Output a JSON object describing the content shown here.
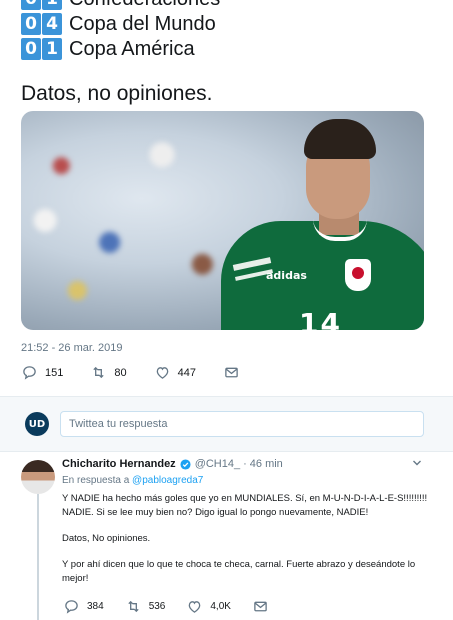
{
  "stats": [
    {
      "digits": [
        "0",
        "1"
      ],
      "label": "Confederaciones"
    },
    {
      "digits": [
        "0",
        "4"
      ],
      "label": "Copa del Mundo"
    },
    {
      "digits": [
        "0",
        "1"
      ],
      "label": "Copa América"
    }
  ],
  "tweet": {
    "text": "Datos, no opiniones.",
    "timestamp": "21:52 - 26 mar. 2019",
    "jersey_number": "14",
    "jersey_brand": "adidas",
    "replies": "151",
    "retweets": "80",
    "likes": "447"
  },
  "reply_composer": {
    "avatar_text": "UD",
    "placeholder": "Twittea tu respuesta"
  },
  "reply": {
    "name": "Chicharito Hernandez",
    "handle": "@CH14_",
    "separator": "·",
    "time": "46 min",
    "in_reply_prefix": "En respuesta a",
    "in_reply_handle": "@pabloagreda7",
    "paragraphs": [
      "Y NADIE ha hecho más goles que yo en MUNDIALES. Sí, en M-U-N-D-I-A-L-E-S!!!!!!!!! NADIE. Si se lee muy bien no? Digo igual lo pongo nuevamente, NADIE!",
      "Datos, No opiniones.",
      "Y por ahí dicen que lo que te choca te checa, carnal. Fuerte abrazo y deseándote lo mejor!"
    ],
    "replies": "384",
    "retweets": "536",
    "likes": "4,0K"
  },
  "icons": [
    "reply-icon",
    "retweet-icon",
    "like-icon",
    "message-icon",
    "verified-icon",
    "chevron-down-icon"
  ],
  "colors": {
    "accent": "#1da1f2",
    "digit_bg": "#3b94d9",
    "muted": "#657786",
    "jersey": "#0f6b3d"
  }
}
